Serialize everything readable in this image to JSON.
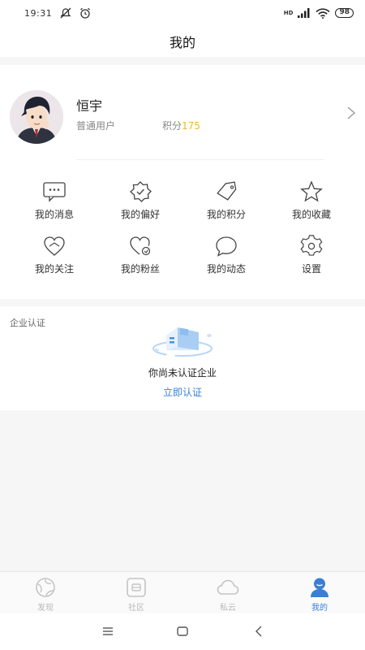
{
  "status": {
    "time": "19:31",
    "battery": "98",
    "network": "HD"
  },
  "header": {
    "title": "我的"
  },
  "profile": {
    "name": "恒宇",
    "type": "普通用户",
    "points_label": "积分",
    "points_value": "175"
  },
  "menu": [
    {
      "label": "我的消息",
      "icon": "message-icon"
    },
    {
      "label": "我的偏好",
      "icon": "preference-badge-icon"
    },
    {
      "label": "我的积分",
      "icon": "tag-icon"
    },
    {
      "label": "我的收藏",
      "icon": "star-icon"
    },
    {
      "label": "我的关注",
      "icon": "heart-icon"
    },
    {
      "label": "我的粉丝",
      "icon": "fans-heart-icon"
    },
    {
      "label": "我的动态",
      "icon": "chat-bubble-icon"
    },
    {
      "label": "设置",
      "icon": "settings-gear-icon"
    }
  ],
  "enterprise": {
    "title": "企业认证",
    "message": "你尚未认证企业",
    "action": "立即认证"
  },
  "tabs": [
    {
      "label": "发现",
      "icon": "discover-globe-icon",
      "active": false
    },
    {
      "label": "社区",
      "icon": "community-icon",
      "active": false
    },
    {
      "label": "私云",
      "icon": "cloud-icon",
      "active": false
    },
    {
      "label": "我的",
      "icon": "profile-person-icon",
      "active": true
    }
  ],
  "colors": {
    "accent": "#3a7fd5",
    "points": "#f2b62f",
    "inactive": "#b8b8b8"
  }
}
